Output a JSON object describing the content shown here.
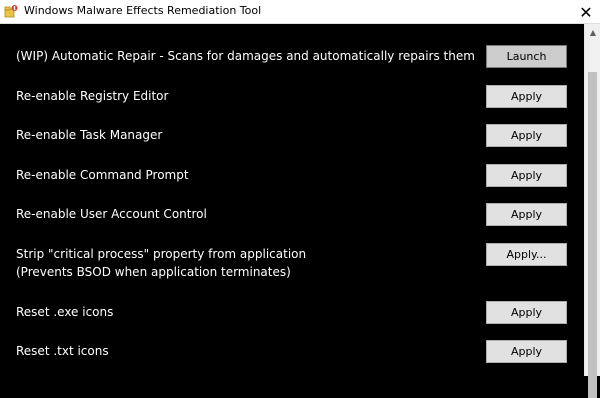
{
  "window": {
    "title": "Windows Malware Effects Remediation Tool",
    "icon": "app-icon",
    "close_glyph": "✕"
  },
  "rows": [
    {
      "label": "(WIP) Automatic Repair - Scans for damages and automatically repairs them",
      "button": "Launch"
    },
    {
      "label": "Re-enable Registry Editor",
      "button": "Apply"
    },
    {
      "label": "Re-enable Task Manager",
      "button": "Apply"
    },
    {
      "label": "Re-enable Command Prompt",
      "button": "Apply"
    },
    {
      "label": "Re-enable User Account Control",
      "button": "Apply"
    },
    {
      "label": "Strip \"critical process\" property from application",
      "label2": "(Prevents BSOD when application terminates)",
      "button": "Apply..."
    },
    {
      "label": "Reset .exe icons",
      "button": "Apply"
    },
    {
      "label": "Reset .txt icons",
      "button": "Apply"
    }
  ],
  "scrollbar": {
    "up_glyph": "▲"
  },
  "colors": {
    "background": "#000000",
    "text": "#ffffff",
    "button": "#e1e1e1",
    "titlebar": "#ffffff"
  }
}
